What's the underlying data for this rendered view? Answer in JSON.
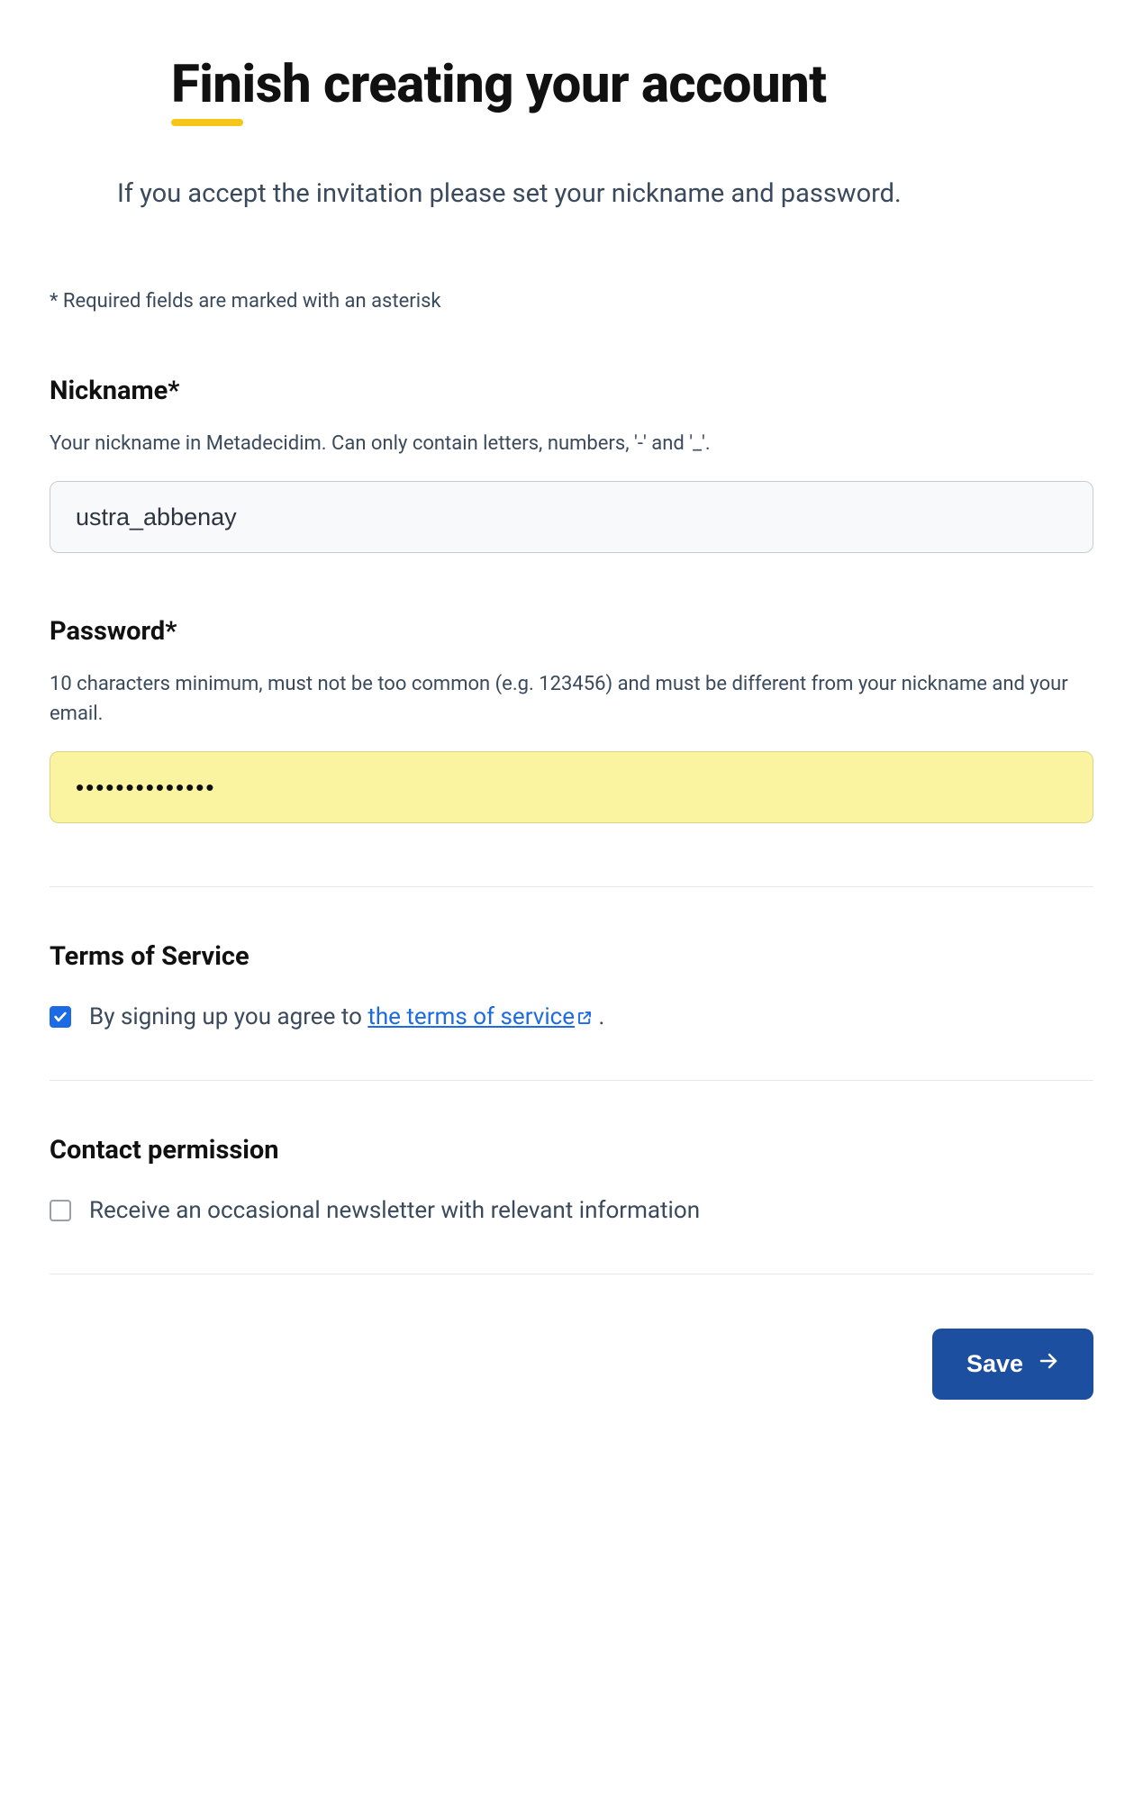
{
  "title": "Finish creating your account",
  "intro": "If you accept the invitation please set your nickname and password.",
  "required_note": "* Required fields are marked with an asterisk",
  "nickname": {
    "label": "Nickname*",
    "help": "Your nickname in Metadecidim. Can only contain letters, numbers, '-' and '_'.",
    "value": "ustra_abbenay"
  },
  "password": {
    "label": "Password*",
    "help": "10 characters minimum, must not be too common (e.g. 123456) and must be different from your nickname and your email.",
    "value": "••••••••••••••"
  },
  "tos": {
    "heading": "Terms of Service",
    "prefix": "By signing up you agree to ",
    "link_text": "the terms of service",
    "suffix": " .",
    "checked": true
  },
  "contact": {
    "heading": "Contact permission",
    "label": "Receive an occasional newsletter with relevant information",
    "checked": false
  },
  "save_label": "Save"
}
